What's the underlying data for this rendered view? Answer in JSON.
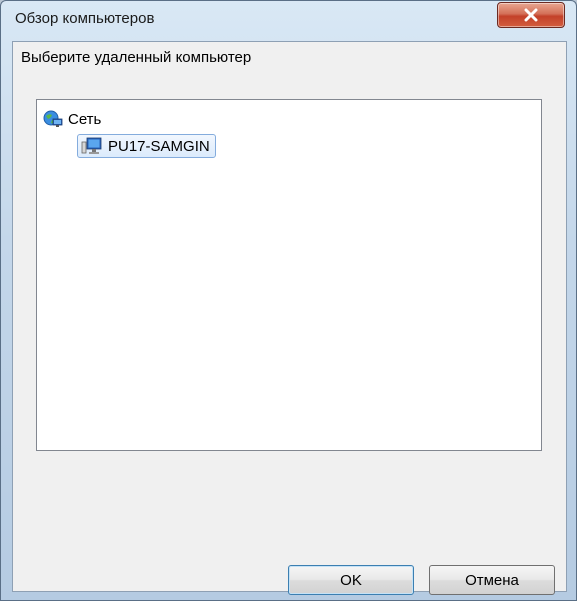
{
  "window": {
    "title": "Обзор компьютеров",
    "close_icon": "close-icon"
  },
  "dialog": {
    "prompt": "Выберите удаленный компьютер"
  },
  "tree": {
    "items": [
      {
        "label": "Сеть",
        "icon": "network-globe-icon",
        "level": 0,
        "selected": false
      },
      {
        "label": "PU17-SAMGIN",
        "icon": "computer-icon",
        "level": 1,
        "selected": true
      }
    ]
  },
  "buttons": {
    "ok_label": "OK",
    "cancel_label": "Отмена"
  },
  "colors": {
    "close_button": "#c3412a",
    "selection_border": "#84acdd",
    "selection_fill": "#dcebfc"
  }
}
